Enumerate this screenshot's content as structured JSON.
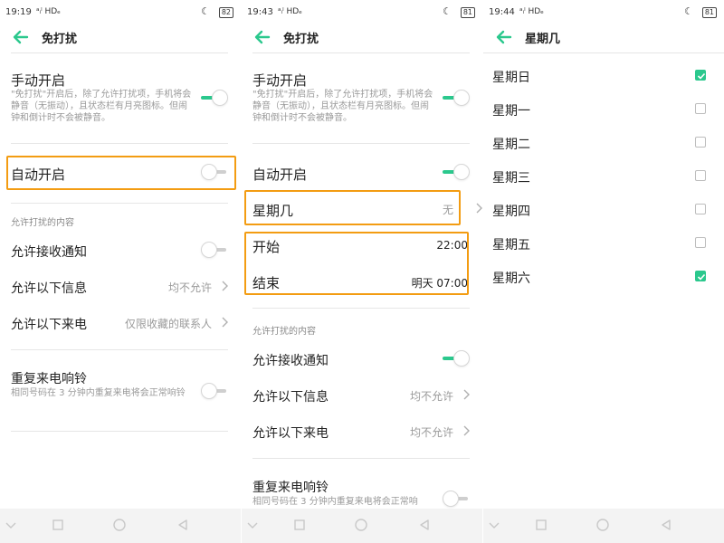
{
  "panel1": {
    "status": {
      "time": "19:19",
      "signal": "ᵃᵢˡ HDₑ",
      "battery": "82"
    },
    "title": "免打扰",
    "manual_label": "手动开启",
    "manual_desc": "\"免打扰\"开启后，除了允许打扰项，手机将会静音（无振动），且状态栏有月亮图标。但闹钟和倒计时不会被静音。",
    "manual_on": true,
    "auto_label": "自动开启",
    "auto_on": false,
    "section_allow": "允许打扰的内容",
    "notify_label": "允许接收通知",
    "notify_on": false,
    "msg_label": "允许以下信息",
    "msg_value": "均不允许",
    "call_label": "允许以下来电",
    "call_value": "仅限收藏的联系人",
    "repeat_label": "重复来电响铃",
    "repeat_desc": "相同号码在 3 分钟内重复来电将会正常响铃",
    "repeat_on": false
  },
  "panel2": {
    "status": {
      "time": "19:43",
      "signal": "ᵃᵢˡ HDₑ",
      "battery": "81"
    },
    "title": "免打扰",
    "manual_label": "手动开启",
    "manual_desc": "\"免打扰\"开启后，除了允许打扰项，手机将会静音（无振动），且状态栏有月亮图标。但闹钟和倒计时不会被静音。",
    "manual_on": true,
    "auto_label": "自动开启",
    "auto_on": true,
    "weekday_label": "星期几",
    "weekday_value": "无",
    "start_label": "开始",
    "start_value": "22:00",
    "end_label": "结束",
    "end_value": "明天 07:00",
    "section_allow": "允许打扰的内容",
    "notify_label": "允许接收通知",
    "notify_on": true,
    "msg_label": "允许以下信息",
    "msg_value": "均不允许",
    "call_label": "允许以下来电",
    "call_value": "均不允许",
    "repeat_label": "重复来电响铃",
    "repeat_desc": "相同号码在 3 分钟内重复来电将会正常响",
    "repeat_on": false
  },
  "panel3": {
    "status": {
      "time": "19:44",
      "signal": "ᵃᵢˡ HDₑ",
      "battery": "81"
    },
    "title": "星期几",
    "days": [
      {
        "label": "星期日",
        "checked": true
      },
      {
        "label": "星期一",
        "checked": false
      },
      {
        "label": "星期二",
        "checked": false
      },
      {
        "label": "星期三",
        "checked": false
      },
      {
        "label": "星期四",
        "checked": false
      },
      {
        "label": "星期五",
        "checked": false
      },
      {
        "label": "星期六",
        "checked": true
      }
    ]
  },
  "colors": {
    "accent": "#2bc88d",
    "highlight": "#f39c12",
    "navbar": "#f3f3f3"
  },
  "icons": {
    "back": "arrow-left-icon",
    "chevron": "chevron-right-icon",
    "moon": "moon-icon"
  }
}
